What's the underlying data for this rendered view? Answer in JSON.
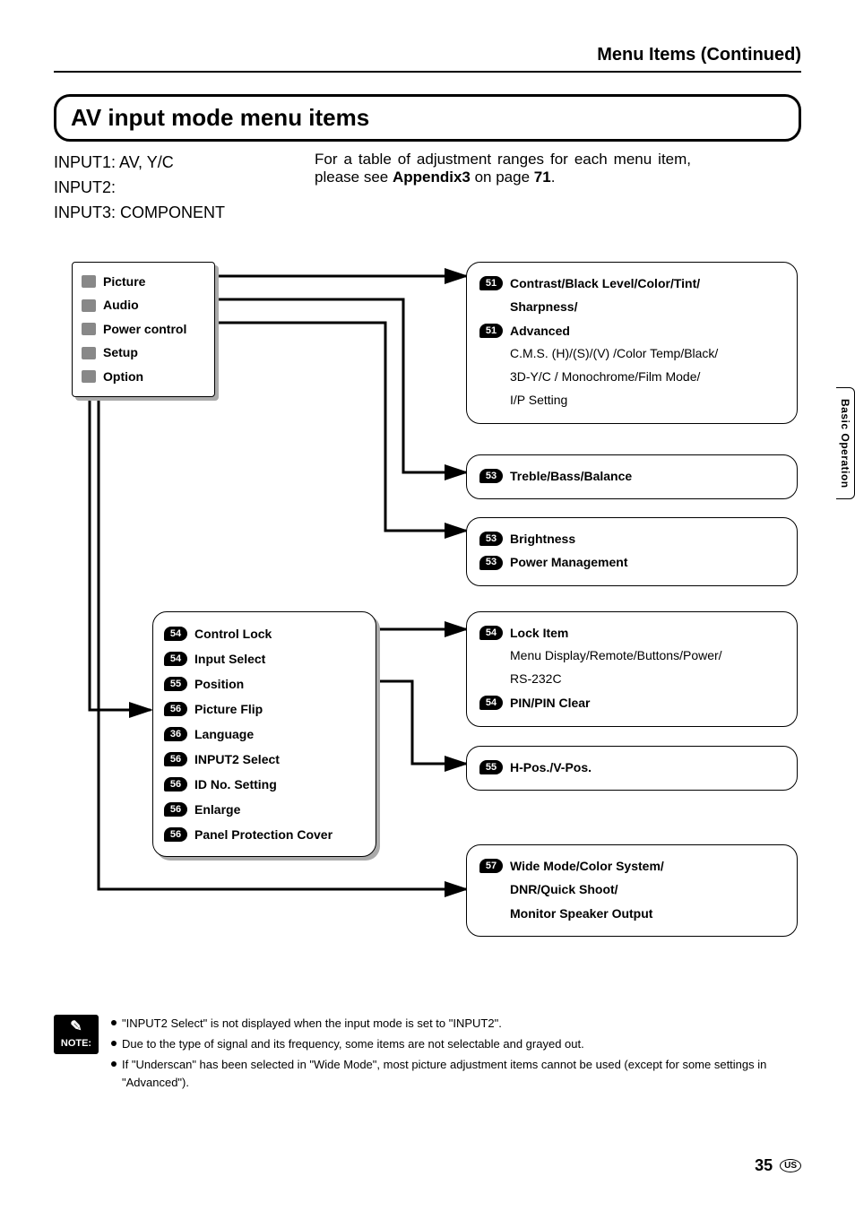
{
  "header": {
    "title": "Menu Items (Continued)"
  },
  "section_title": "AV input mode menu items",
  "inputs": {
    "line1": "INPUT1: AV, Y/C",
    "line2": "INPUT2:",
    "line3": "INPUT3: COMPONENT"
  },
  "description": {
    "pre": "For a table of adjustment ranges for each menu item, please see ",
    "bold": "Appendix3",
    "mid": " on page ",
    "page": "71",
    "post": "."
  },
  "menu": {
    "items": [
      "Picture",
      "Audio",
      "Power control",
      "Setup",
      "Option"
    ]
  },
  "setup_items": [
    {
      "page": "54",
      "label": "Control Lock"
    },
    {
      "page": "54",
      "label": "Input Select"
    },
    {
      "page": "55",
      "label": "Position"
    },
    {
      "page": "56",
      "label": "Picture Flip"
    },
    {
      "page": "36",
      "label": "Language"
    },
    {
      "page": "56",
      "label": "INPUT2 Select"
    },
    {
      "page": "56",
      "label": "ID No. Setting"
    },
    {
      "page": "56",
      "label": "Enlarge"
    },
    {
      "page": "56",
      "label": "Panel Protection Cover"
    }
  ],
  "panels": {
    "picture": {
      "row1_page": "51",
      "row1_label": "Contrast/Black Level/Color/Tint/",
      "row1b": "Sharpness/",
      "row2_page": "51",
      "row2_label": "Advanced",
      "detail1": "C.M.S. (H)/(S)/(V) /Color Temp/Black/",
      "detail2": "3D-Y/C / Monochrome/Film Mode/",
      "detail3": "I/P Setting"
    },
    "audio": {
      "page": "53",
      "label": "Treble/Bass/Balance"
    },
    "power": {
      "row1_page": "53",
      "row1_label": "Brightness",
      "row2_page": "53",
      "row2_label": "Power Management"
    },
    "lock": {
      "row1_page": "54",
      "row1_label": "Lock Item",
      "detail1": "Menu Display/Remote/Buttons/Power/",
      "detail2": "RS-232C",
      "row2_page": "54",
      "row2_label": "PIN/PIN Clear"
    },
    "position": {
      "page": "55",
      "label": "H-Pos./V-Pos."
    },
    "option": {
      "page": "57",
      "line1": "Wide Mode/Color System/",
      "line2": "DNR/Quick Shoot/",
      "line3": "Monitor Speaker Output"
    }
  },
  "side_tab": "Basic Operation",
  "note": {
    "label": "NOTE:",
    "items": [
      "\"INPUT2 Select\" is not displayed when the input mode is set to \"INPUT2\".",
      "Due to the type of signal and its frequency, some items are not selectable and grayed out.",
      "If \"Underscan\" has been selected in \"Wide Mode\", most picture adjustment items cannot be used (except for some settings in \"Advanced\")."
    ]
  },
  "footer": {
    "page": "35",
    "region": "US"
  }
}
